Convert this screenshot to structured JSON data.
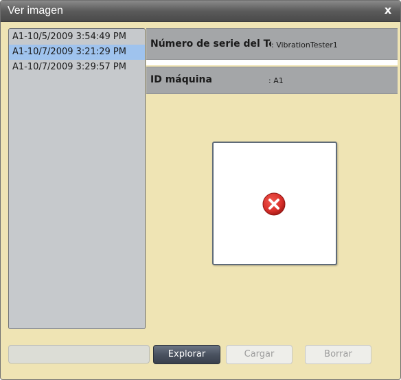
{
  "window": {
    "title": "Ver imagen",
    "close_label": "x"
  },
  "list": {
    "items": [
      {
        "label": "A1-10/5/2009 3:54:49 PM",
        "selected": false
      },
      {
        "label": "A1-10/7/2009 3:21:29 PM",
        "selected": true
      },
      {
        "label": "A1-10/7/2009 3:29:57 PM",
        "selected": false
      }
    ]
  },
  "info": {
    "serial_label": "Número de serie del Tester",
    "serial_value": ": VibrationTester1",
    "machine_label": "ID máquina",
    "machine_value": ": A1"
  },
  "image": {
    "status_icon": "error-icon"
  },
  "footer": {
    "path_value": "",
    "explore_label": "Explorar",
    "load_label": "Cargar",
    "delete_label": "Borrar"
  },
  "colors": {
    "background": "#efe4b4",
    "selection": "#9fc3ee",
    "error": "#d9302b"
  }
}
